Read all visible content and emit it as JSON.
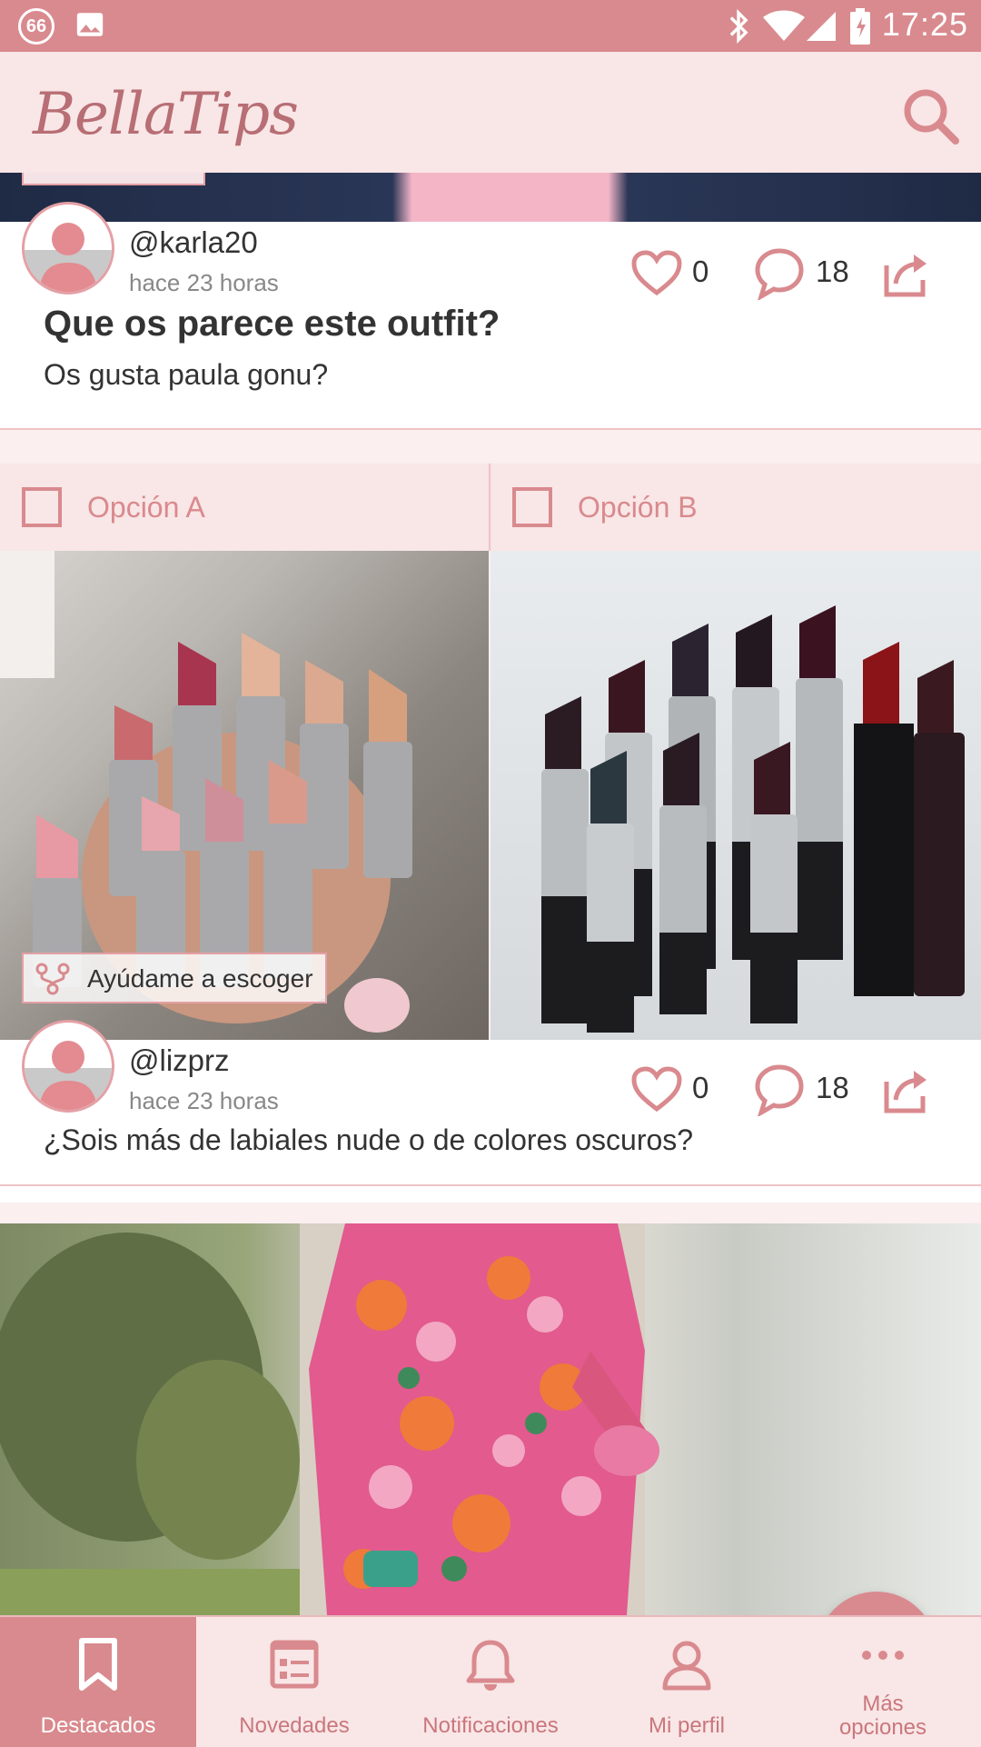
{
  "status_bar": {
    "notification_badge": "66",
    "time": "17:25",
    "icons": [
      "notification-count-icon",
      "image-icon",
      "bluetooth-icon",
      "wifi-icon",
      "signal-icon",
      "battery-charging-icon"
    ]
  },
  "app_bar": {
    "logo_text": "BellaTips",
    "search_icon": "search-icon"
  },
  "colors": {
    "accent": "#d98a8e",
    "app_bar_bg": "#f9e6e7",
    "feed_bg": "#fbeff0",
    "text_primary": "#333333",
    "text_secondary": "#888888"
  },
  "posts": [
    {
      "username": "@karla20",
      "time": "hace 23 horas",
      "likes": "0",
      "comments": "18",
      "title": "Que os parece este outfit?",
      "text": "Os gusta paula gonu?"
    },
    {
      "option_a": "Opción A",
      "option_b": "Opción B",
      "help_label": "Ayúdame a escoger",
      "username": "@lizprz",
      "time": "hace 23 horas",
      "likes": "0",
      "comments": "18",
      "text": "¿Sois más de labiales nude o de colores oscuros?"
    }
  ],
  "fab": {
    "label": "+"
  },
  "bottom_nav": {
    "active": "Destacados",
    "items": [
      {
        "label": "Destacados",
        "icon": "bookmark-icon"
      },
      {
        "label": "Novedades",
        "icon": "news-icon"
      },
      {
        "label": "Notificaciones",
        "icon": "bell-icon"
      },
      {
        "label": "Mi perfil",
        "icon": "person-icon"
      },
      {
        "label_line1": "Más",
        "label_line2": "opciones",
        "icon": "more-icon"
      }
    ]
  }
}
